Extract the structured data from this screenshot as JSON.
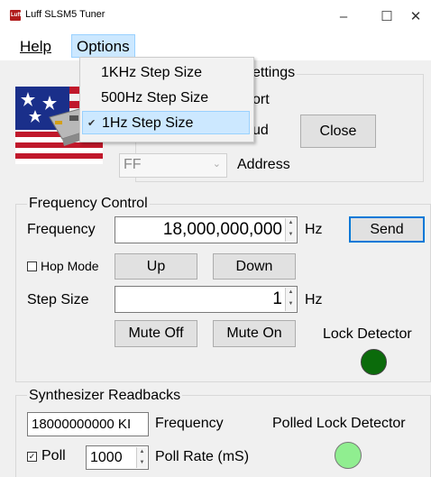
{
  "window": {
    "title": "Luff SLSM5 Tuner",
    "icon_text": "Luff"
  },
  "menubar": {
    "help": "Help",
    "options": "Options"
  },
  "options_menu": {
    "items": [
      {
        "label": "1KHz Step Size",
        "checked": false
      },
      {
        "label": "500Hz Step Size",
        "checked": false
      },
      {
        "label": "1Hz Step Size",
        "checked": true
      }
    ]
  },
  "settings": {
    "group_title_partial": "ettings",
    "port_partial": "ort",
    "baud_partial": "ud",
    "close_button": "Close",
    "address_value": "FF",
    "address_label": "Address"
  },
  "frequency_control": {
    "title": "Frequency Control",
    "frequency_label": "Frequency",
    "frequency_value": "18,000,000,000",
    "frequency_unit": "Hz",
    "send_button": "Send",
    "hop_mode_label": "Hop Mode",
    "up_button": "Up",
    "down_button": "Down",
    "step_size_label": "Step Size",
    "step_size_value": "1",
    "step_size_unit": "Hz",
    "mute_off_button": "Mute Off",
    "mute_on_button": "Mute On",
    "lock_detector_label": "Lock Detector",
    "lock_detector_color": "#0b6b0b"
  },
  "synth_readbacks": {
    "title": "Synthesizer Readbacks",
    "frequency_value": "18000000000 KI",
    "frequency_label": "Frequency",
    "polled_lock_label": "Polled Lock Detector",
    "polled_lock_color": "#90ee90",
    "poll_label": "Poll",
    "poll_checked": true,
    "poll_rate_value": "1000",
    "poll_rate_label": "Poll Rate (mS)"
  }
}
